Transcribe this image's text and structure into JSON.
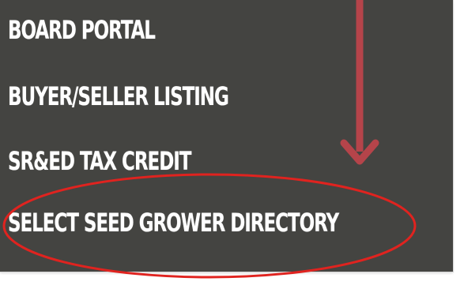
{
  "menu": {
    "items": [
      {
        "label": "BOARD PORTAL"
      },
      {
        "label": "BUYER/SELLER LISTING"
      },
      {
        "label": "SR&ED TAX CREDIT"
      },
      {
        "label": "SELECT SEED GROWER DIRECTORY"
      }
    ]
  },
  "annotation": {
    "arrow_color": "#b5444a",
    "ellipse_color": "#e0231f",
    "highlighted_item": "SELECT SEED GROWER DIRECTORY"
  }
}
